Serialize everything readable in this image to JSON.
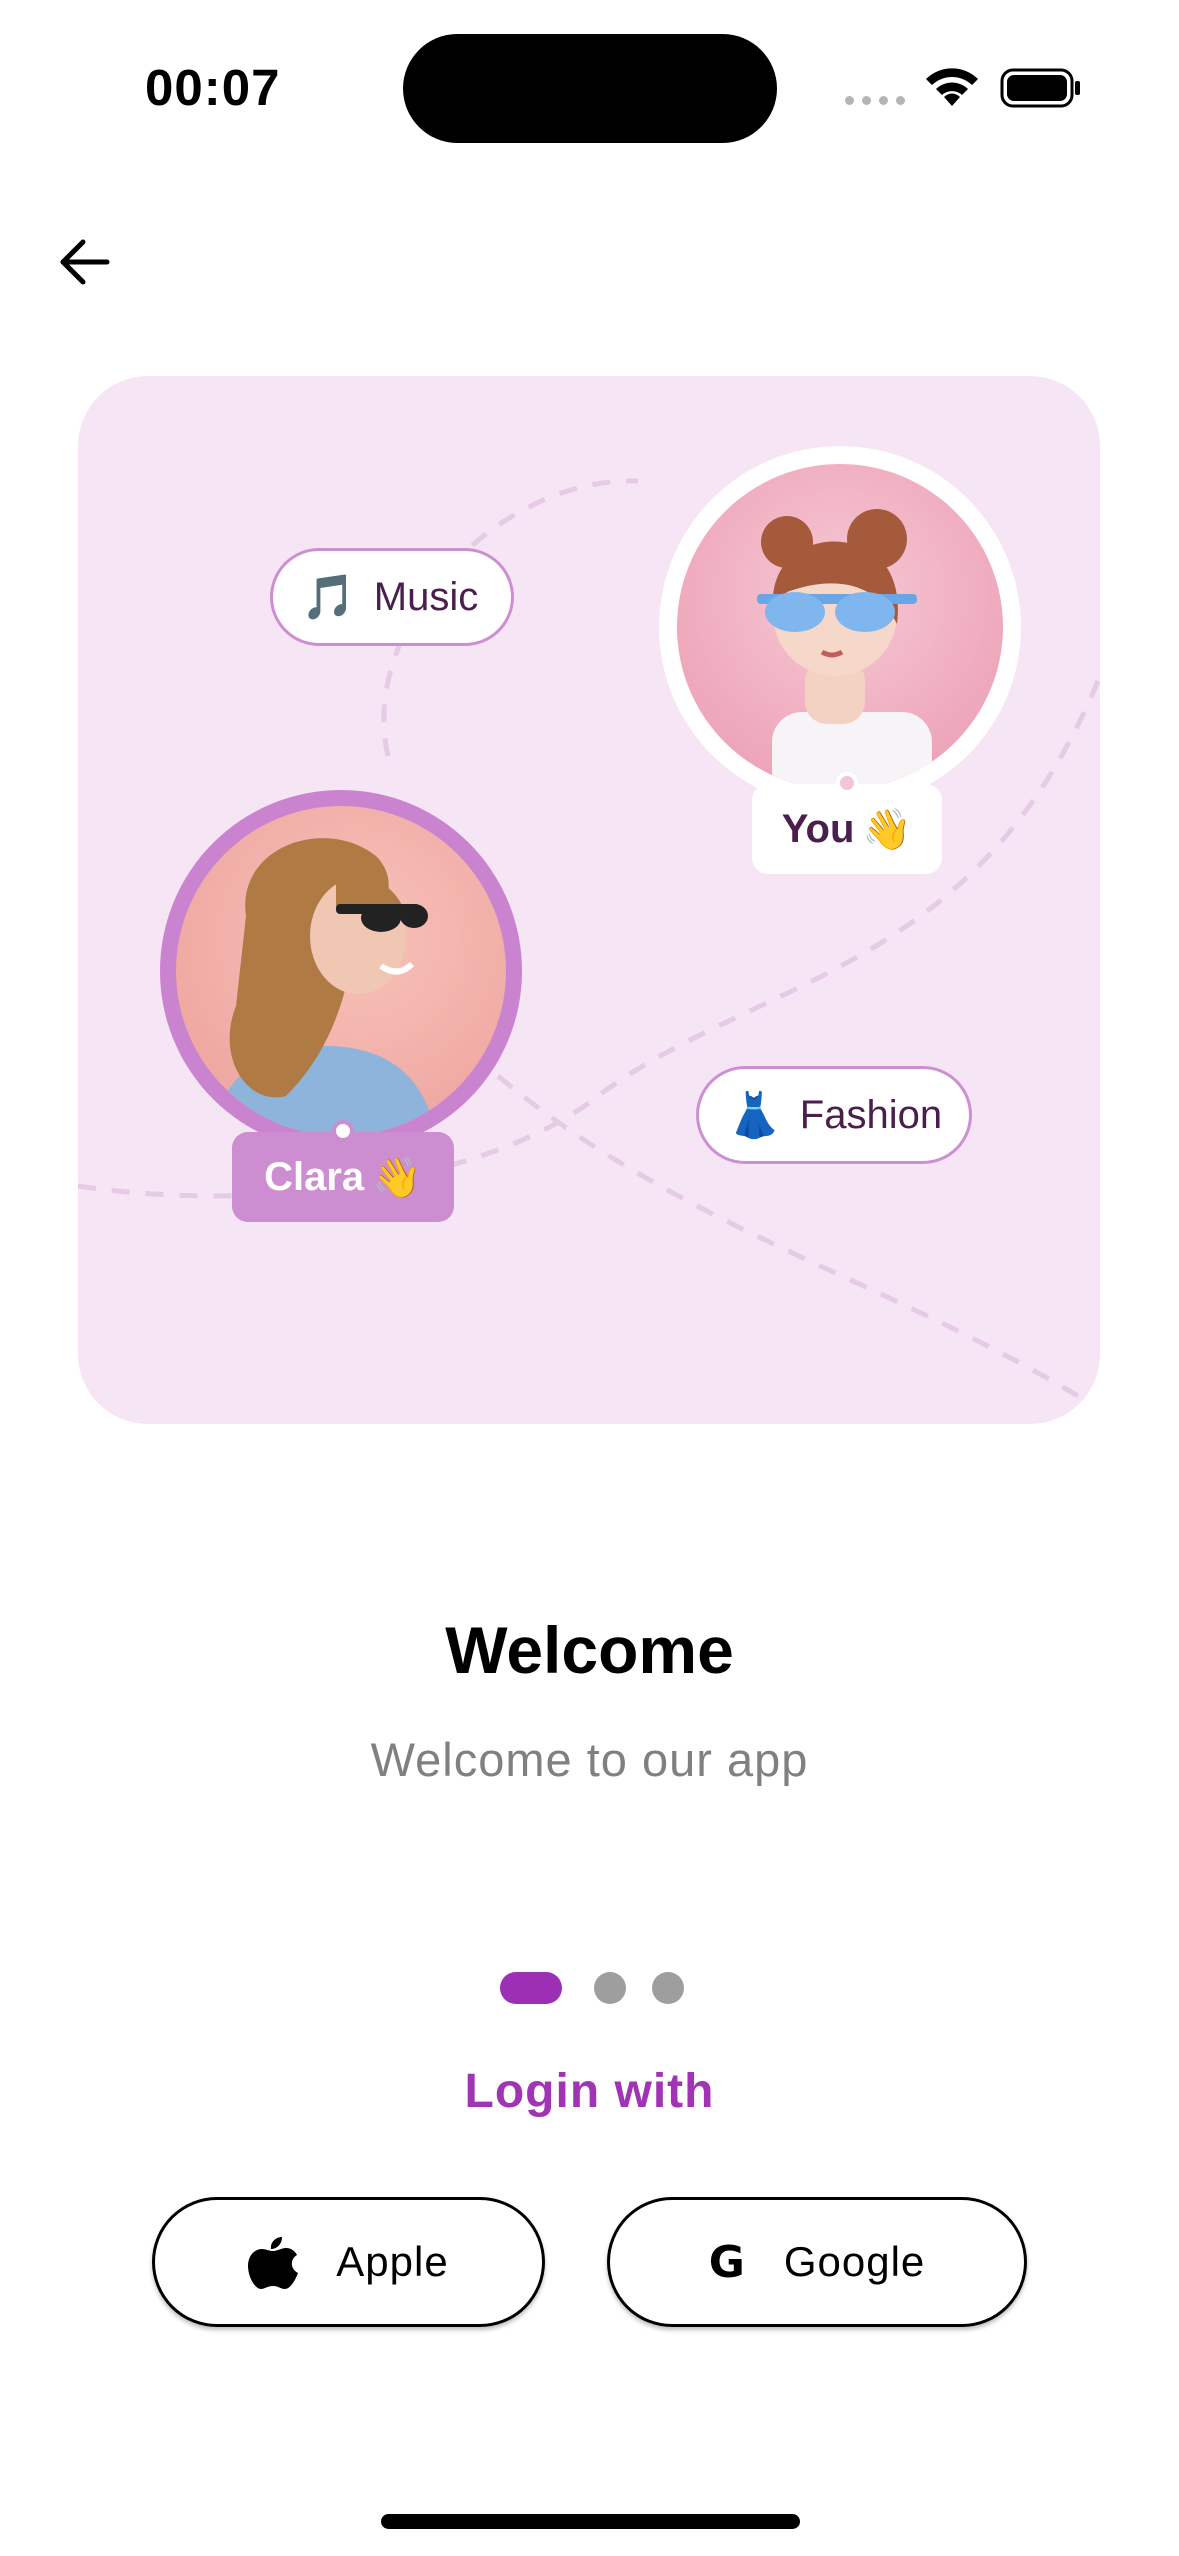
{
  "status_bar": {
    "time": "00:07"
  },
  "navigation": {
    "back_icon": "arrow-left-icon"
  },
  "illustration": {
    "chips": [
      {
        "emoji": "🎵",
        "label": "Music"
      },
      {
        "emoji": "👗",
        "label": "Fashion"
      }
    ],
    "you_tag": {
      "label": "You",
      "emoji": "👋"
    },
    "clara_tag": {
      "label": "Clara",
      "emoji": "👋"
    }
  },
  "onboarding": {
    "title": "Welcome",
    "subtitle": "Welcome to our app",
    "page_indicator": {
      "current": 1,
      "total": 3
    }
  },
  "login": {
    "heading": "Login with",
    "apple_label": "Apple",
    "google_label": "Google",
    "google_icon_glyph": "G"
  },
  "colors": {
    "accent": "#a034b5",
    "card_background": "#f5e5f5",
    "clara_accent": "#cd8dd1"
  }
}
